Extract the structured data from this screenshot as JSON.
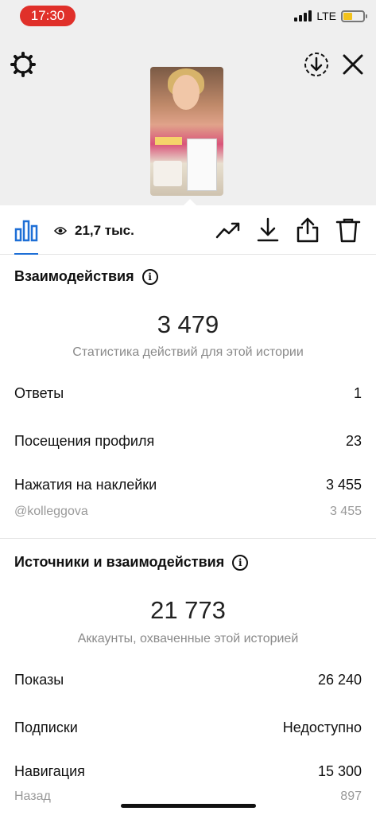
{
  "status_bar": {
    "time": "17:30",
    "network": "LTE",
    "time_pill_color": "#e0302a",
    "battery_color": "#f2c21b",
    "battery_level": 0.45
  },
  "header": {
    "settings_icon": "gear-icon",
    "download_icon": "download-circle-icon",
    "close_icon": "close-icon"
  },
  "toolbar": {
    "views_count": "21,7 тыс.",
    "icons": [
      "bar-chart-icon",
      "eye-icon",
      "trend-icon",
      "download-icon",
      "share-icon",
      "trash-icon"
    ],
    "active_color": "#1e6fd6"
  },
  "interactions": {
    "title": "Взаимодействия",
    "total": "3 479",
    "caption": "Статистика действий для этой истории",
    "rows": [
      {
        "label": "Ответы",
        "value": "1"
      },
      {
        "label": "Посещения профиля",
        "value": "23"
      },
      {
        "label": "Нажатия на наклейки",
        "value": "3 455"
      }
    ],
    "sub_row": {
      "label": "@kolleggova",
      "value": "3 455"
    }
  },
  "sources": {
    "title": "Источники и взаимодействия",
    "total": "21 773",
    "caption": "Аккаунты, охваченные этой историей",
    "rows": [
      {
        "label": "Показы",
        "value": "26 240"
      },
      {
        "label": "Подписки",
        "value": "Недоступно"
      },
      {
        "label": "Навигация",
        "value": "15 300"
      }
    ],
    "sub_row": {
      "label": "Назад",
      "value": "897"
    }
  }
}
